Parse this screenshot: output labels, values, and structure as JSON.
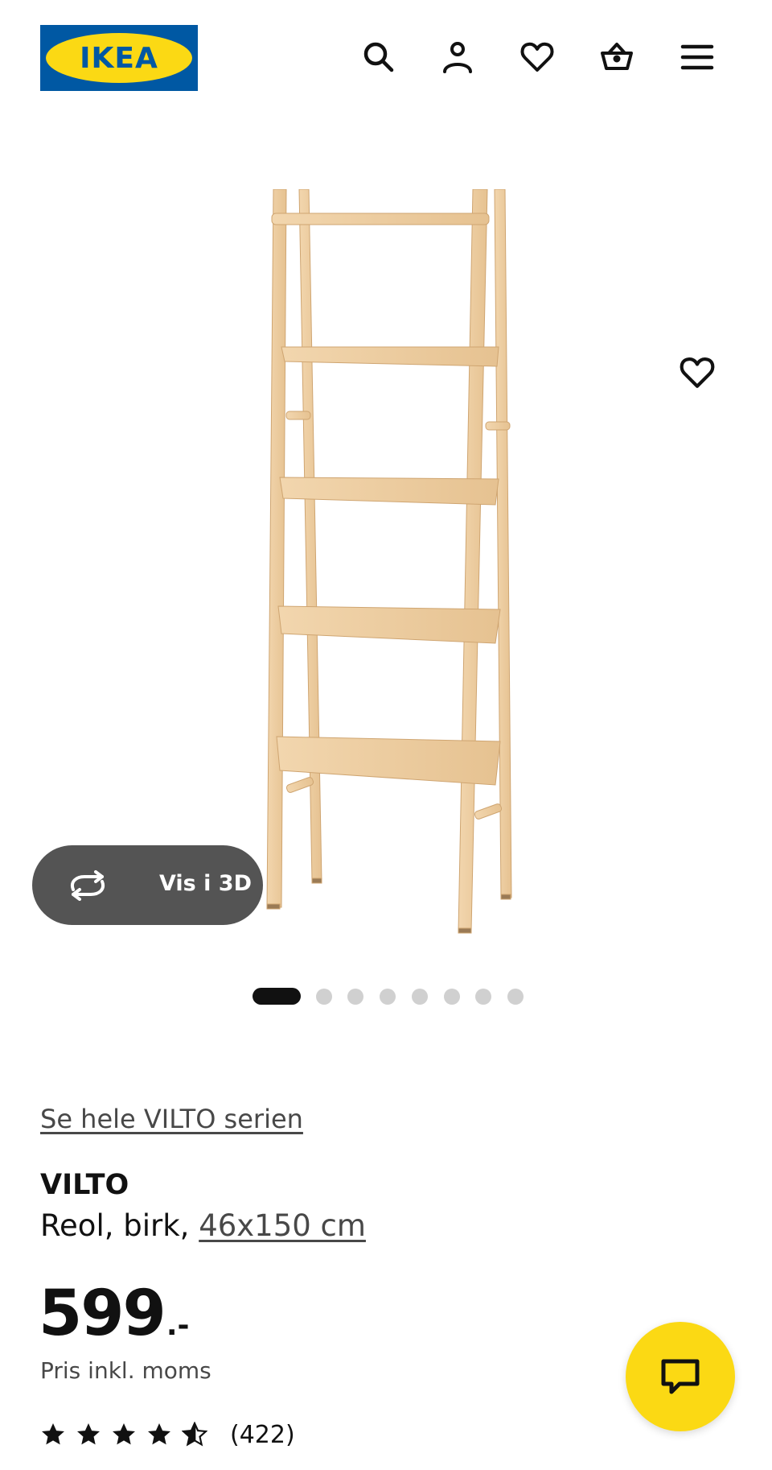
{
  "header": {
    "logo_text": "IKEA",
    "logo_registered": "®",
    "icons": [
      "search-icon",
      "account-icon",
      "favorites-icon",
      "basket-icon",
      "menu-icon"
    ]
  },
  "gallery": {
    "view_3d_label": "Vis i 3D",
    "slide_count": 8,
    "active_slide": 1
  },
  "product": {
    "series_link": "Se hele VILTO serien",
    "name": "VILTO",
    "description": "Reol, birk, ",
    "size_link": "46x150 cm",
    "price_integer": "599",
    "price_suffix": ".-",
    "price_note": "Pris inkl. moms",
    "rating_value": 4.5,
    "rating_max": 5,
    "review_count": "(422)"
  },
  "colors": {
    "brand_blue": "#0058A3",
    "brand_yellow": "#FBD914",
    "button_dark": "#545454",
    "wood": "#EFCFA2"
  }
}
